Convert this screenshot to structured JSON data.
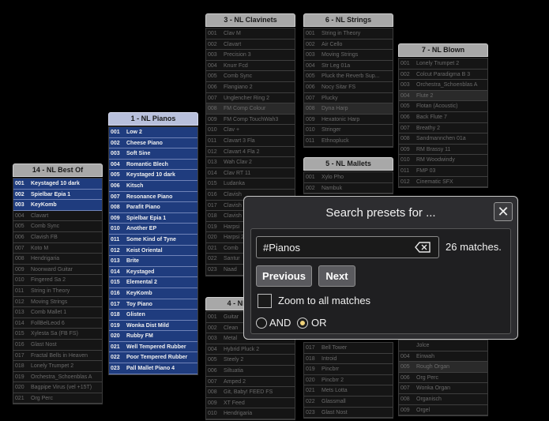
{
  "columns": [
    {
      "id": "c14",
      "title": "14 - NL Best Of",
      "highlighted": false,
      "rows": [
        {
          "n": "001",
          "t": "Keystaged 10 dark",
          "hi": true
        },
        {
          "n": "002",
          "t": "Spielbar Epia 1",
          "hi": true
        },
        {
          "n": "003",
          "t": "KeyKomb",
          "hi": true
        },
        {
          "n": "004",
          "t": "Clavart",
          "hi": false
        },
        {
          "n": "005",
          "t": "Comb Sync",
          "hi": false
        },
        {
          "n": "006",
          "t": "Clavish FB",
          "hi": false
        },
        {
          "n": "007",
          "t": "Koto M",
          "hi": false
        },
        {
          "n": "008",
          "t": "Hendrigaria",
          "hi": false
        },
        {
          "n": "009",
          "t": "Noonward Guitar",
          "hi": false
        },
        {
          "n": "010",
          "t": "Fingered Sa 2",
          "hi": false
        },
        {
          "n": "011",
          "t": "String in Theory",
          "hi": false
        },
        {
          "n": "012",
          "t": "Moving Strings",
          "hi": false
        },
        {
          "n": "013",
          "t": "Comb Mallet 1",
          "hi": false
        },
        {
          "n": "014",
          "t": "FollBelLeod 6",
          "hi": false
        },
        {
          "n": "015",
          "t": "Xylesta Sa (FB FS)",
          "hi": false
        },
        {
          "n": "016",
          "t": "Glast Nost",
          "hi": false
        },
        {
          "n": "017",
          "t": "Fractal Bells in Heaven",
          "hi": false
        },
        {
          "n": "018",
          "t": "Lonely Trumpet 2",
          "hi": false
        },
        {
          "n": "019",
          "t": "Orchestra_Schoenblas A",
          "hi": false
        },
        {
          "n": "020",
          "t": "Bagpipe Virus (vel +15T)",
          "hi": false
        },
        {
          "n": "021",
          "t": "Org Perc",
          "hi": false
        }
      ]
    },
    {
      "id": "c1",
      "title": "1 - NL Pianos",
      "highlighted": true,
      "rows": [
        {
          "n": "001",
          "t": "Low 2",
          "hi": true
        },
        {
          "n": "002",
          "t": "Cheese Piano",
          "hi": true
        },
        {
          "n": "003",
          "t": "Soft Sine",
          "hi": true
        },
        {
          "n": "004",
          "t": "Romantic Blech",
          "hi": true
        },
        {
          "n": "005",
          "t": "Keystaged 10 dark",
          "hi": true
        },
        {
          "n": "006",
          "t": "Kitsch",
          "hi": true
        },
        {
          "n": "007",
          "t": "Resonance Piano",
          "hi": true
        },
        {
          "n": "008",
          "t": "Parafit Piano",
          "hi": true
        },
        {
          "n": "009",
          "t": "Spielbar Epia 1",
          "hi": true
        },
        {
          "n": "010",
          "t": "Another EP",
          "hi": true
        },
        {
          "n": "011",
          "t": "Some Kind of Tyne",
          "hi": true
        },
        {
          "n": "012",
          "t": "Keist Oriental",
          "hi": true
        },
        {
          "n": "013",
          "t": "Brite",
          "hi": true
        },
        {
          "n": "014",
          "t": "Keystaged",
          "hi": true
        },
        {
          "n": "015",
          "t": "Elemental 2",
          "hi": true
        },
        {
          "n": "016",
          "t": "KeyKomb",
          "hi": true
        },
        {
          "n": "017",
          "t": "Toy Piano",
          "hi": true
        },
        {
          "n": "018",
          "t": "Glisten",
          "hi": true
        },
        {
          "n": "019",
          "t": "Wonka Dist Mild",
          "hi": true
        },
        {
          "n": "020",
          "t": "Rubby FM",
          "hi": true
        },
        {
          "n": "021",
          "t": "Well Tempered Rubber",
          "hi": true
        },
        {
          "n": "022",
          "t": "Poor Tempered Rubber",
          "hi": true
        },
        {
          "n": "023",
          "t": "Pall Mallet Piano 4",
          "hi": true
        }
      ]
    },
    {
      "id": "c3",
      "title": "3 - NL Clavinets",
      "highlighted": false,
      "rows": [
        {
          "n": "001",
          "t": "Clav M",
          "hi": false
        },
        {
          "n": "002",
          "t": "Clavart",
          "hi": false
        },
        {
          "n": "003",
          "t": "Precision 3",
          "hi": false
        },
        {
          "n": "004",
          "t": "Knurr Fcd",
          "hi": false
        },
        {
          "n": "005",
          "t": "Comb Sync",
          "hi": false
        },
        {
          "n": "006",
          "t": "Flangiano 2",
          "hi": false
        },
        {
          "n": "007",
          "t": "Unglencher Ring 2",
          "hi": false
        },
        {
          "n": "008",
          "t": "FM Comp Colour",
          "hi": false,
          "dark": true
        },
        {
          "n": "009",
          "t": "FM Comp TouchWah3",
          "hi": false
        },
        {
          "n": "010",
          "t": "Clav +",
          "hi": false
        },
        {
          "n": "011",
          "t": "Clavart 3 Fla",
          "hi": false
        },
        {
          "n": "012",
          "t": "Clavart 4 Fla 2",
          "hi": false
        },
        {
          "n": "013",
          "t": "Wah Clav 2",
          "hi": false
        },
        {
          "n": "014",
          "t": "Clav RT 11",
          "hi": false
        },
        {
          "n": "015",
          "t": "Ludanka",
          "hi": false
        },
        {
          "n": "016",
          "t": "Clavish",
          "hi": false
        },
        {
          "n": "017",
          "t": "Clavish FB",
          "hi": false
        },
        {
          "n": "018",
          "t": "Clavish",
          "hi": false
        },
        {
          "n": "019",
          "t": "Harpsi",
          "hi": false
        },
        {
          "n": "020",
          "t": "Harpsi 2",
          "hi": false
        },
        {
          "n": "021",
          "t": "Comb",
          "hi": false
        },
        {
          "n": "022",
          "t": "Santur",
          "hi": false
        },
        {
          "n": "023",
          "t": "Naad",
          "hi": false
        }
      ]
    },
    {
      "id": "c4",
      "title": "4 - NL Guitars",
      "highlighted": false,
      "rows": [
        {
          "n": "001",
          "t": "Guitar",
          "hi": false
        },
        {
          "n": "002",
          "t": "Clean",
          "hi": false
        },
        {
          "n": "003",
          "t": "Metal",
          "hi": false
        },
        {
          "n": "004",
          "t": "Hybrid Pluck 2",
          "hi": false
        },
        {
          "n": "005",
          "t": "Steely 2",
          "hi": false
        },
        {
          "n": "006",
          "t": "Siltuatia",
          "hi": false
        },
        {
          "n": "007",
          "t": "Amped 2",
          "hi": false
        },
        {
          "n": "008",
          "t": "Git, Baby! FEED FS",
          "hi": false
        },
        {
          "n": "009",
          "t": "XT Feed",
          "hi": false
        },
        {
          "n": "010",
          "t": "Hendrigaria",
          "hi": false
        }
      ]
    },
    {
      "id": "c6",
      "title": "6 - NL Strings",
      "highlighted": false,
      "rows": [
        {
          "n": "001",
          "t": "String in Theory",
          "hi": false
        },
        {
          "n": "002",
          "t": "Air Cello",
          "hi": false
        },
        {
          "n": "003",
          "t": "Moving Strings",
          "hi": false
        },
        {
          "n": "004",
          "t": "Str Leg 01a",
          "hi": false
        },
        {
          "n": "005",
          "t": "Pluck the Reverb Sup...",
          "hi": false
        },
        {
          "n": "006",
          "t": "Nocy Sitar FS",
          "hi": false
        },
        {
          "n": "007",
          "t": "Plucky",
          "hi": false
        },
        {
          "n": "008",
          "t": "Dyna Harp",
          "hi": false,
          "dark": true
        },
        {
          "n": "009",
          "t": "Hexatonic Harp",
          "hi": false
        },
        {
          "n": "010",
          "t": "Stringer",
          "hi": false
        },
        {
          "n": "011",
          "t": "Ethnopluck",
          "hi": false
        }
      ]
    },
    {
      "id": "c5",
      "title": "5 - NL Mallets",
      "highlighted": false,
      "rows": [
        {
          "n": "001",
          "t": "Xylo Pho",
          "hi": false
        },
        {
          "n": "002",
          "t": "Nambuk",
          "hi": false
        }
      ]
    },
    {
      "id": "c5b",
      "title": "",
      "highlighted": false,
      "rows": [
        {
          "n": "017",
          "t": "Bell Tower",
          "hi": false
        },
        {
          "n": "018",
          "t": "Introid",
          "hi": false
        },
        {
          "n": "019",
          "t": "Pincbrr",
          "hi": false
        },
        {
          "n": "020",
          "t": "Pincbrr 2",
          "hi": false
        },
        {
          "n": "021",
          "t": "Mets Lotta",
          "hi": false
        },
        {
          "n": "022",
          "t": "Glassmall",
          "hi": false
        },
        {
          "n": "023",
          "t": "Glast Nost",
          "hi": false
        }
      ]
    },
    {
      "id": "c7",
      "title": "7 - NL Blown",
      "highlighted": false,
      "rows": [
        {
          "n": "001",
          "t": "Lonely Trumpet 2",
          "hi": false
        },
        {
          "n": "002",
          "t": "Colcut Paradigma B 3",
          "hi": false
        },
        {
          "n": "003",
          "t": "Orchestra_Schoenblas A",
          "hi": false
        },
        {
          "n": "004",
          "t": "Flute 2",
          "hi": false,
          "dark": true
        },
        {
          "n": "005",
          "t": "Flotan (Acoustic)",
          "hi": false
        },
        {
          "n": "006",
          "t": "Back Flute 7",
          "hi": false
        },
        {
          "n": "007",
          "t": "Breathy 2",
          "hi": false
        },
        {
          "n": "008",
          "t": "Sandmannchen 01a",
          "hi": false
        },
        {
          "n": "009",
          "t": "RM Brassy 11",
          "hi": false
        },
        {
          "n": "010",
          "t": "RM Woodwindy",
          "hi": false
        },
        {
          "n": "011",
          "t": "FMP 03",
          "hi": false
        },
        {
          "n": "012",
          "t": "Cinematic SFX",
          "hi": false
        }
      ]
    },
    {
      "id": "c8",
      "title": "",
      "highlighted": false,
      "rows": [
        {
          "n": "",
          "t": "Jolce",
          "hi": false
        },
        {
          "n": "004",
          "t": "Einwah",
          "hi": false
        },
        {
          "n": "005",
          "t": "Rough Organ",
          "hi": false,
          "dark": true
        },
        {
          "n": "006",
          "t": "Org Perc",
          "hi": false
        },
        {
          "n": "007",
          "t": "Wonka Organ",
          "hi": false
        },
        {
          "n": "008",
          "t": "Organisch",
          "hi": false
        },
        {
          "n": "009",
          "t": "Orgel",
          "hi": false
        }
      ]
    }
  ],
  "dialog": {
    "title": "Search presets for ...",
    "close_label": "✕",
    "search_value": "#Pianos",
    "matches": "26 matches.",
    "previous_label": "Previous",
    "next_label": "Next",
    "zoom_label": "Zoom to all matches",
    "zoom_checked": false,
    "and_label": "AND",
    "or_label": "OR",
    "selected_mode": "OR"
  },
  "colors": {
    "highlight_row": "#1f3c7e",
    "header_grey": "#a8a8a8",
    "header_blue": "#b8c0dc",
    "radio_selected": "#f0d27a"
  }
}
